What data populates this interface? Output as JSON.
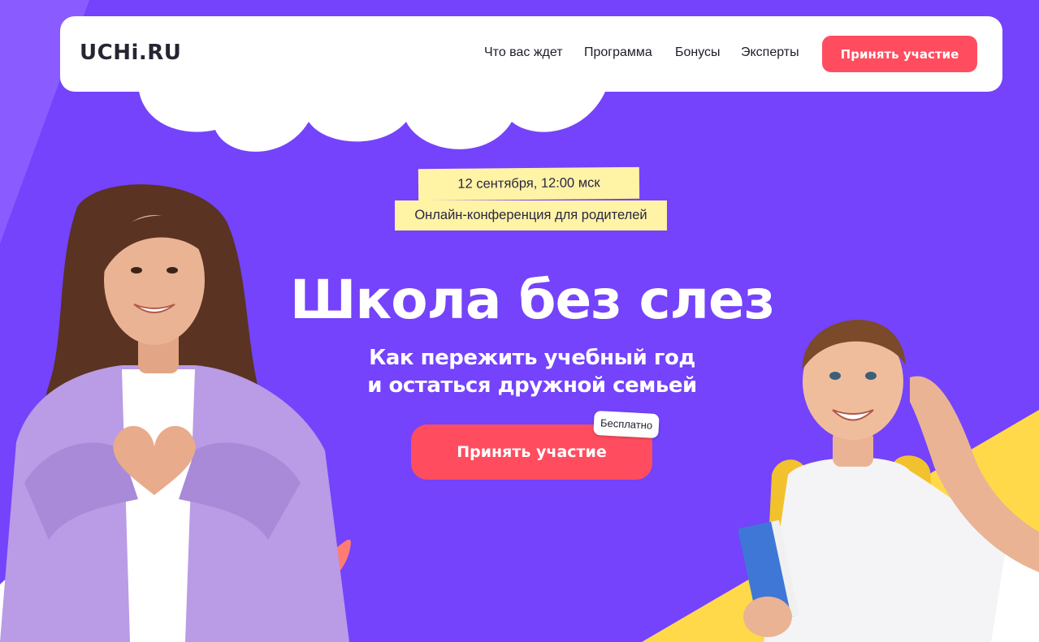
{
  "header": {
    "logo": "UCHi.RU",
    "nav": [
      "Что вас ждет",
      "Программа",
      "Бонусы",
      "Эксперты"
    ],
    "cta_label": "Принять участие"
  },
  "hero": {
    "date_tag": "12 сентября, 12:00 мск",
    "event_tag": "Онлайн-конференция для родителей",
    "title": "Школа без слез",
    "subtitle_line1": "Как пережить учебный год",
    "subtitle_line2": "и остаться дружной семьей",
    "cta_label": "Принять участие",
    "badge": "Бесплатно"
  },
  "colors": {
    "background": "#7443fb",
    "accent": "#ff4d5f",
    "tag_yellow": "#fff3a6",
    "shape_yellow": "#ffd94a",
    "shape_coral": "#ff7c73"
  },
  "images": {
    "woman": "photo-woman-heart-gesture",
    "boy": "photo-boy-with-backpack-and-book"
  }
}
